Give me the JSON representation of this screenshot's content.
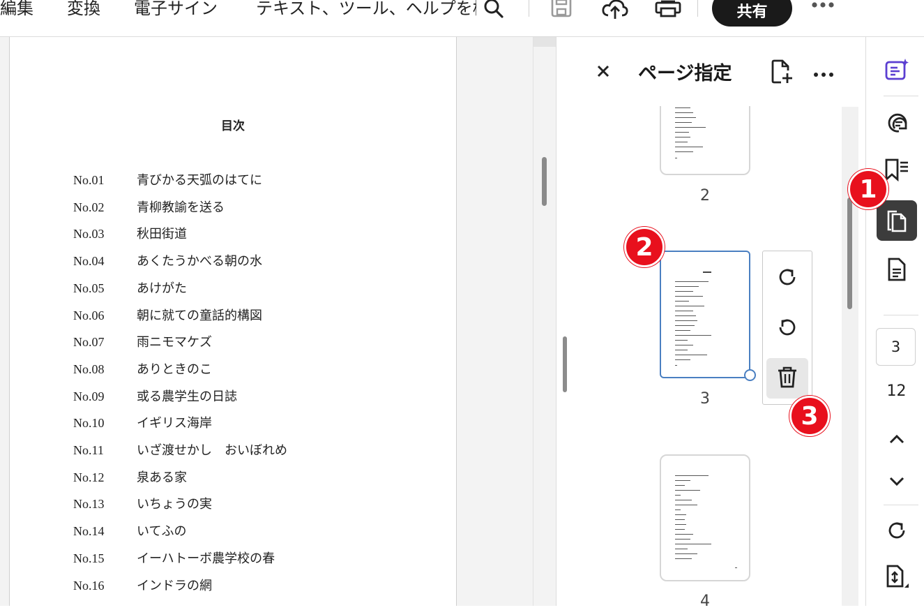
{
  "toolbar": {
    "menu_edit": "編集",
    "menu_convert": "変換",
    "menu_esign": "電子サイン",
    "search_text": "テキスト、ツール、ヘルプを検索",
    "share_label": "共有",
    "icons": [
      "search-icon",
      "save-icon",
      "cloud-upload-icon",
      "print-icon",
      "more-icon"
    ]
  },
  "document": {
    "title": "目次",
    "toc": [
      {
        "no": "No.01",
        "title": "青びかる天弧のはてに"
      },
      {
        "no": "No.02",
        "title": "青柳教諭を送る"
      },
      {
        "no": "No.03",
        "title": "秋田街道"
      },
      {
        "no": "No.04",
        "title": "あくたうかべる朝の水"
      },
      {
        "no": "No.05",
        "title": "あけがた"
      },
      {
        "no": "No.06",
        "title": "朝に就ての童話的構図"
      },
      {
        "no": "No.07",
        "title": "雨ニモマケズ"
      },
      {
        "no": "No.08",
        "title": "ありときのこ"
      },
      {
        "no": "No.09",
        "title": "或る農学生の日誌"
      },
      {
        "no": "No.10",
        "title": "イギリス海岸"
      },
      {
        "no": "No.11",
        "title": "いざ渡せかし　おいぼれめ"
      },
      {
        "no": "No.12",
        "title": "泉ある家"
      },
      {
        "no": "No.13",
        "title": "いちょうの実"
      },
      {
        "no": "No.14",
        "title": "いてふの"
      },
      {
        "no": "No.15",
        "title": "イーハトーボ農学校の春"
      },
      {
        "no": "No.16",
        "title": "インドラの網"
      }
    ]
  },
  "panel": {
    "title": "ページ指定",
    "pages": [
      {
        "number": "2",
        "selected": false
      },
      {
        "number": "3",
        "selected": true
      },
      {
        "number": "4",
        "selected": false
      }
    ],
    "actions": [
      "rotate-clockwise",
      "rotate-counterclockwise",
      "delete"
    ]
  },
  "rail": {
    "current_page": "3",
    "total_pages": "12"
  },
  "badges": {
    "one": "1",
    "two": "2",
    "three": "3"
  },
  "colors": {
    "accent_purple": "#5b3fd1",
    "badge_red": "#e8101d",
    "selection_blue": "#4a7fc1",
    "active_rail": "#3c3c3c",
    "share_button": "#1a1a1a"
  }
}
